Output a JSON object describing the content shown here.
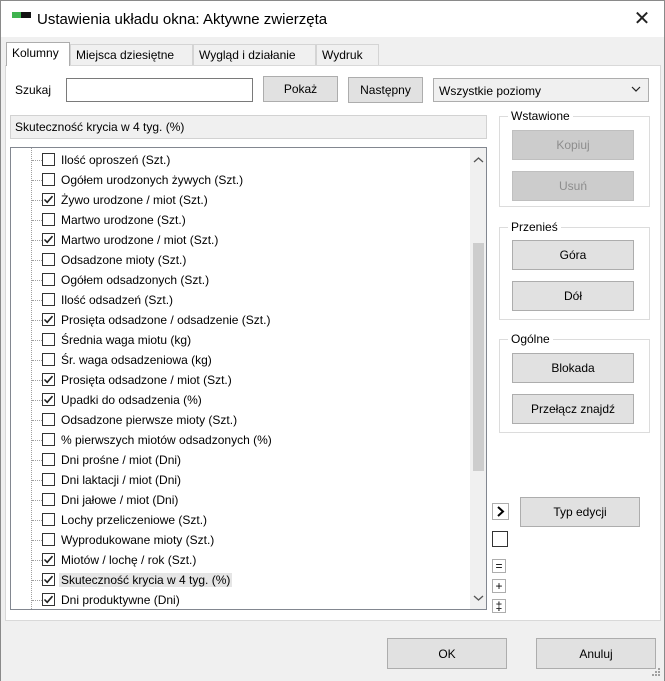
{
  "window": {
    "title": "Ustawienia układu okna: Aktywne zwierzęta",
    "close_glyph": "✕"
  },
  "tabs": [
    {
      "label": "Kolumny",
      "active": true
    },
    {
      "label": "Miejsca dziesiętne",
      "active": false
    },
    {
      "label": "Wygląd i działanie",
      "active": false
    },
    {
      "label": "Wydruk",
      "active": false
    }
  ],
  "search": {
    "label": "Szukaj",
    "value": "",
    "show_label": "Pokaż",
    "next_label": "Następny"
  },
  "level_select": {
    "value": "Wszystkie poziomy"
  },
  "selected_field": "Skuteczność krycia w 4 tyg. (%)",
  "columns": [
    {
      "label": "Ilość oproszeń (Szt.)",
      "checked": false,
      "selected": false
    },
    {
      "label": "Ogółem urodzonych żywych (Szt.)",
      "checked": false,
      "selected": false
    },
    {
      "label": "Żywo urodzone / miot (Szt.)",
      "checked": true,
      "selected": false
    },
    {
      "label": "Martwo urodzone (Szt.)",
      "checked": false,
      "selected": false
    },
    {
      "label": "Martwo urodzone / miot (Szt.)",
      "checked": true,
      "selected": false
    },
    {
      "label": "Odsadzone mioty (Szt.)",
      "checked": false,
      "selected": false
    },
    {
      "label": "Ogółem odsadzonych (Szt.)",
      "checked": false,
      "selected": false
    },
    {
      "label": "Ilość odsadzeń (Szt.)",
      "checked": false,
      "selected": false
    },
    {
      "label": "Prosięta odsadzone / odsadzenie (Szt.)",
      "checked": true,
      "selected": false
    },
    {
      "label": "Średnia waga miotu (kg)",
      "checked": false,
      "selected": false
    },
    {
      "label": "Śr. waga odsadzeniowa (kg)",
      "checked": false,
      "selected": false
    },
    {
      "label": "Prosięta odsadzone / miot (Szt.)",
      "checked": true,
      "selected": false
    },
    {
      "label": "Upadki do odsadzenia (%)",
      "checked": true,
      "selected": false
    },
    {
      "label": "Odsadzone pierwsze mioty (Szt.)",
      "checked": false,
      "selected": false
    },
    {
      "label": "% pierwszych miotów odsadzonych (%)",
      "checked": false,
      "selected": false
    },
    {
      "label": "Dni prośne / miot (Dni)",
      "checked": false,
      "selected": false
    },
    {
      "label": "Dni laktacji / miot (Dni)",
      "checked": false,
      "selected": false
    },
    {
      "label": "Dni jałowe / miot (Dni)",
      "checked": false,
      "selected": false
    },
    {
      "label": "Lochy przeliczeniowe (Szt.)",
      "checked": false,
      "selected": false
    },
    {
      "label": "Wyprodukowane mioty (Szt.)",
      "checked": false,
      "selected": false
    },
    {
      "label": "Miotów / lochę / rok (Szt.)",
      "checked": true,
      "selected": false
    },
    {
      "label": "Skuteczność krycia w 4 tyg. (%)",
      "checked": true,
      "selected": true
    },
    {
      "label": "Dni produktywne (Dni)",
      "checked": true,
      "selected": false
    }
  ],
  "groups": {
    "inserted": {
      "title": "Wstawione",
      "copy_label": "Kopiuj",
      "delete_label": "Usuń"
    },
    "move": {
      "title": "Przenieś",
      "up_label": "Góra",
      "down_label": "Dół"
    },
    "general": {
      "title": "Ogólne",
      "lock_label": "Blokada",
      "toggle_find_label": "Przełącz znajdź"
    }
  },
  "edit_type_label": "Typ edycji",
  "side_buttons": {
    "expand": ">",
    "equal": "=",
    "plus": "+",
    "dagger": "‡"
  },
  "footer": {
    "ok_label": "OK",
    "cancel_label": "Anuluj"
  }
}
